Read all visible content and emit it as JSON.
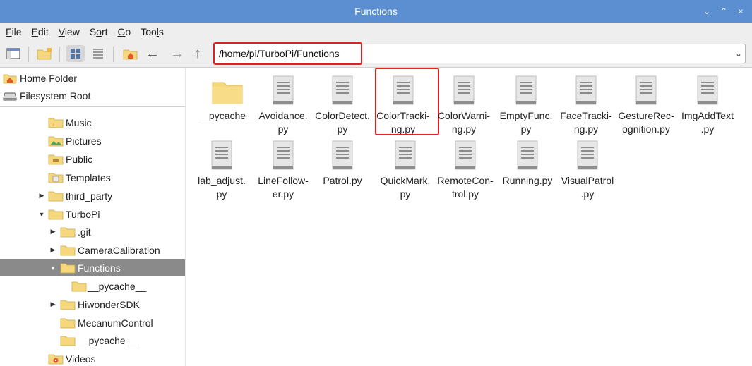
{
  "window": {
    "title": "Functions",
    "controls": [
      "⌄",
      "⌃",
      "×"
    ]
  },
  "menubar": {
    "items": [
      {
        "label": "File",
        "mnemonic_first": "F",
        "rest": "ile"
      },
      {
        "label": "Edit",
        "mnemonic_first": "E",
        "rest": "dit"
      },
      {
        "label": "View",
        "mnemonic_first": "V",
        "rest": "iew"
      },
      {
        "label": "Sort",
        "prefix": "S",
        "mnemonic": "o",
        "suffix": "rt"
      },
      {
        "label": "Go",
        "mnemonic_first": "G",
        "rest": "o"
      },
      {
        "label": "Tools",
        "prefix": "Too",
        "mnemonic": "l",
        "suffix": "s"
      }
    ]
  },
  "toolbar": {
    "path": "/home/pi/TurboPi/Functions",
    "icons": [
      "new-window-icon",
      "new-folder-icon",
      "icon-view-icon",
      "list-view-icon",
      "home-icon",
      "back-icon",
      "forward-icon",
      "up-icon"
    ]
  },
  "sidebar": {
    "places": [
      {
        "label": "Home Folder",
        "icon": "home-folder-icon"
      },
      {
        "label": "Filesystem Root",
        "icon": "drive-icon"
      }
    ],
    "tree": [
      {
        "label": "Music",
        "icon": "music-folder-icon"
      },
      {
        "label": "Pictures",
        "icon": "pictures-folder-icon"
      },
      {
        "label": "Public",
        "icon": "public-folder-icon"
      },
      {
        "label": "Templates",
        "icon": "templates-folder-icon"
      },
      {
        "label": "third_party",
        "icon": "folder-icon"
      },
      {
        "label": "TurboPi",
        "icon": "folder-icon"
      },
      {
        "label": ".git",
        "icon": "folder-icon"
      },
      {
        "label": "CameraCalibration",
        "icon": "folder-icon"
      },
      {
        "label": "Functions",
        "icon": "folder-icon"
      },
      {
        "label": "__pycache__",
        "icon": "folder-icon"
      },
      {
        "label": "HiwonderSDK",
        "icon": "folder-icon"
      },
      {
        "label": "MecanumControl",
        "icon": "folder-icon"
      },
      {
        "label": "__pycache__",
        "icon": "folder-icon"
      },
      {
        "label": "Videos",
        "icon": "videos-folder-icon"
      }
    ]
  },
  "files": [
    {
      "line1": "__pycache__",
      "line2": "",
      "type": "folder"
    },
    {
      "line1": "Avoidance.",
      "line2": "py",
      "type": "file"
    },
    {
      "line1": "ColorDetect.",
      "line2": "py",
      "type": "file"
    },
    {
      "line1": "ColorTracki-",
      "line2": "ng.py",
      "type": "file"
    },
    {
      "line1": "ColorWarni-",
      "line2": "ng.py",
      "type": "file"
    },
    {
      "line1": "EmptyFunc.",
      "line2": "py",
      "type": "file"
    },
    {
      "line1": "FaceTracki-",
      "line2": "ng.py",
      "type": "file"
    },
    {
      "line1": "GestureRec-",
      "line2": "ognition.py",
      "type": "file"
    },
    {
      "line1": "ImgAddText",
      "line2": ".py",
      "type": "file"
    },
    {
      "line1": "lab_adjust.",
      "line2": "py",
      "type": "file"
    },
    {
      "line1": "LineFollow-",
      "line2": "er.py",
      "type": "file"
    },
    {
      "line1": "Patrol.py",
      "line2": "",
      "type": "file"
    },
    {
      "line1": "QuickMark.",
      "line2": "py",
      "type": "file"
    },
    {
      "line1": "RemoteCon-",
      "line2": "trol.py",
      "type": "file"
    },
    {
      "line1": "Running.py",
      "line2": "",
      "type": "file"
    },
    {
      "line1": "VisualPatrol",
      "line2": ".py",
      "type": "file"
    }
  ],
  "colors": {
    "titlebar": "#5b8fd1",
    "highlight": "#e02020",
    "selected_row": "#8a8a8a",
    "folder": "#f5d77e"
  }
}
